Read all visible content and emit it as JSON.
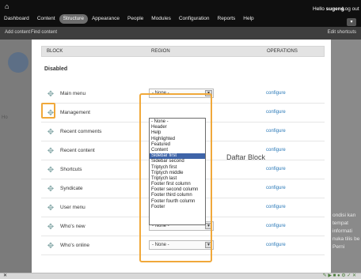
{
  "toolbar": {
    "menu": [
      "Dashboard",
      "Content",
      "Structure",
      "Appearance",
      "People",
      "Modules",
      "Configuration",
      "Reports",
      "Help"
    ],
    "active_index": 2,
    "greeting": "Hello ",
    "username": "sugeng",
    "logout": "Log out",
    "toggle_icon": "chevron-down-icon"
  },
  "shortcuts": {
    "add_content": "Add content",
    "find_content": "Find content",
    "edit_shortcuts": "Edit shortcuts"
  },
  "background": {
    "tab_label": "Ho",
    "right_text": "ondisi kan tempat informati nuka tilis be Perni"
  },
  "table": {
    "headers": {
      "block": "BLOCK",
      "region": "REGION",
      "operations": "OPERATIONS"
    },
    "section": "Disabled",
    "rows": [
      {
        "label": "Main menu",
        "region": "- None -",
        "op": "configure"
      },
      {
        "label": "Management",
        "region": "",
        "op": "configure"
      },
      {
        "label": "Recent comments",
        "region": "",
        "op": "configure"
      },
      {
        "label": "Recent content",
        "region": "",
        "op": "configure"
      },
      {
        "label": "Shortcuts",
        "region": "",
        "op": "configure"
      },
      {
        "label": "Syndicate",
        "region": "",
        "op": "configure"
      },
      {
        "label": "User menu",
        "region": "",
        "op": "configure"
      },
      {
        "label": "Who's new",
        "region": "- None -",
        "op": "configure"
      },
      {
        "label": "Who's online",
        "region": "- None -",
        "op": "configure"
      }
    ]
  },
  "dropdown": {
    "options": [
      "- None -",
      "Header",
      "Help",
      "Highlighted",
      "Featured",
      "Content",
      "Sidebar first",
      "Sidebar second",
      "Triptych first",
      "Triptych middle",
      "Triptych last",
      "Footer first column",
      "Footer second column",
      "Footer third column",
      "Footer fourth column",
      "Footer"
    ],
    "selected": "Sidebar first"
  },
  "annotation": "Daftar Block",
  "colors": {
    "highlight": "#f0a83a",
    "selected_option": "#3e64a8",
    "link": "#2a79b8"
  }
}
